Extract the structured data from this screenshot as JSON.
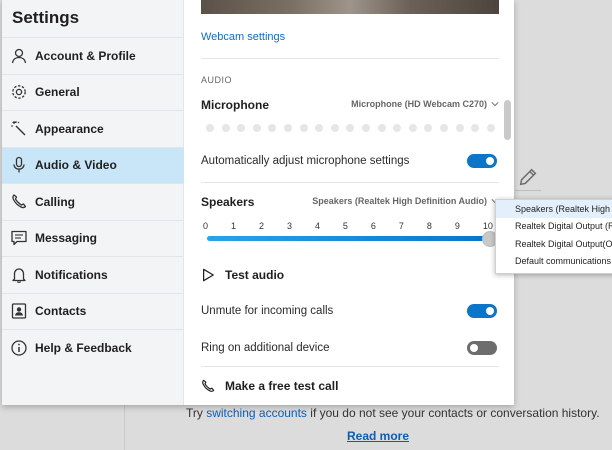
{
  "background": {
    "hint_prefix": "Try ",
    "hint_link": "switching accounts",
    "hint_suffix": " if you do not see your contacts or conversation history.",
    "read_more": "Read more"
  },
  "sidebar": {
    "title": "Settings",
    "active_index": 3,
    "items": [
      {
        "label": "Account & Profile",
        "icon": "person-icon"
      },
      {
        "label": "General",
        "icon": "gear-icon"
      },
      {
        "label": "Appearance",
        "icon": "magic-wand-icon"
      },
      {
        "label": "Audio & Video",
        "icon": "microphone-icon"
      },
      {
        "label": "Calling",
        "icon": "phone-icon"
      },
      {
        "label": "Messaging",
        "icon": "chat-icon"
      },
      {
        "label": "Notifications",
        "icon": "bell-icon"
      },
      {
        "label": "Contacts",
        "icon": "contact-card-icon"
      },
      {
        "label": "Help & Feedback",
        "icon": "info-icon"
      }
    ]
  },
  "content": {
    "webcam_settings_link": "Webcam settings",
    "audio_section_label": "AUDIO",
    "microphone": {
      "title": "Microphone",
      "device": "Microphone (HD Webcam C270)"
    },
    "auto_adjust_mic": {
      "label": "Automatically adjust microphone settings",
      "enabled": true
    },
    "speakers": {
      "title": "Speakers",
      "device": "Speakers (Realtek High Definition Audio)",
      "scale": [
        "0",
        "1",
        "2",
        "3",
        "4",
        "5",
        "6",
        "7",
        "8",
        "9",
        "10"
      ],
      "volume_fraction": 1.0
    },
    "test_audio": "Test audio",
    "unmute_incoming": {
      "label": "Unmute for incoming calls",
      "enabled": true
    },
    "ring_additional": {
      "label": "Ring on additional device",
      "enabled": false
    },
    "test_call": "Make a free test call"
  },
  "speaker_dropdown": {
    "options": [
      "Speakers (Realtek High D",
      "Realtek Digital Output (R",
      "Realtek Digital Output(Op",
      "Default communications"
    ],
    "selected_index": 0
  },
  "colors": {
    "accent": "#0a75c9",
    "active_nav": "#c8e6f8",
    "link": "#0d6ec4"
  }
}
